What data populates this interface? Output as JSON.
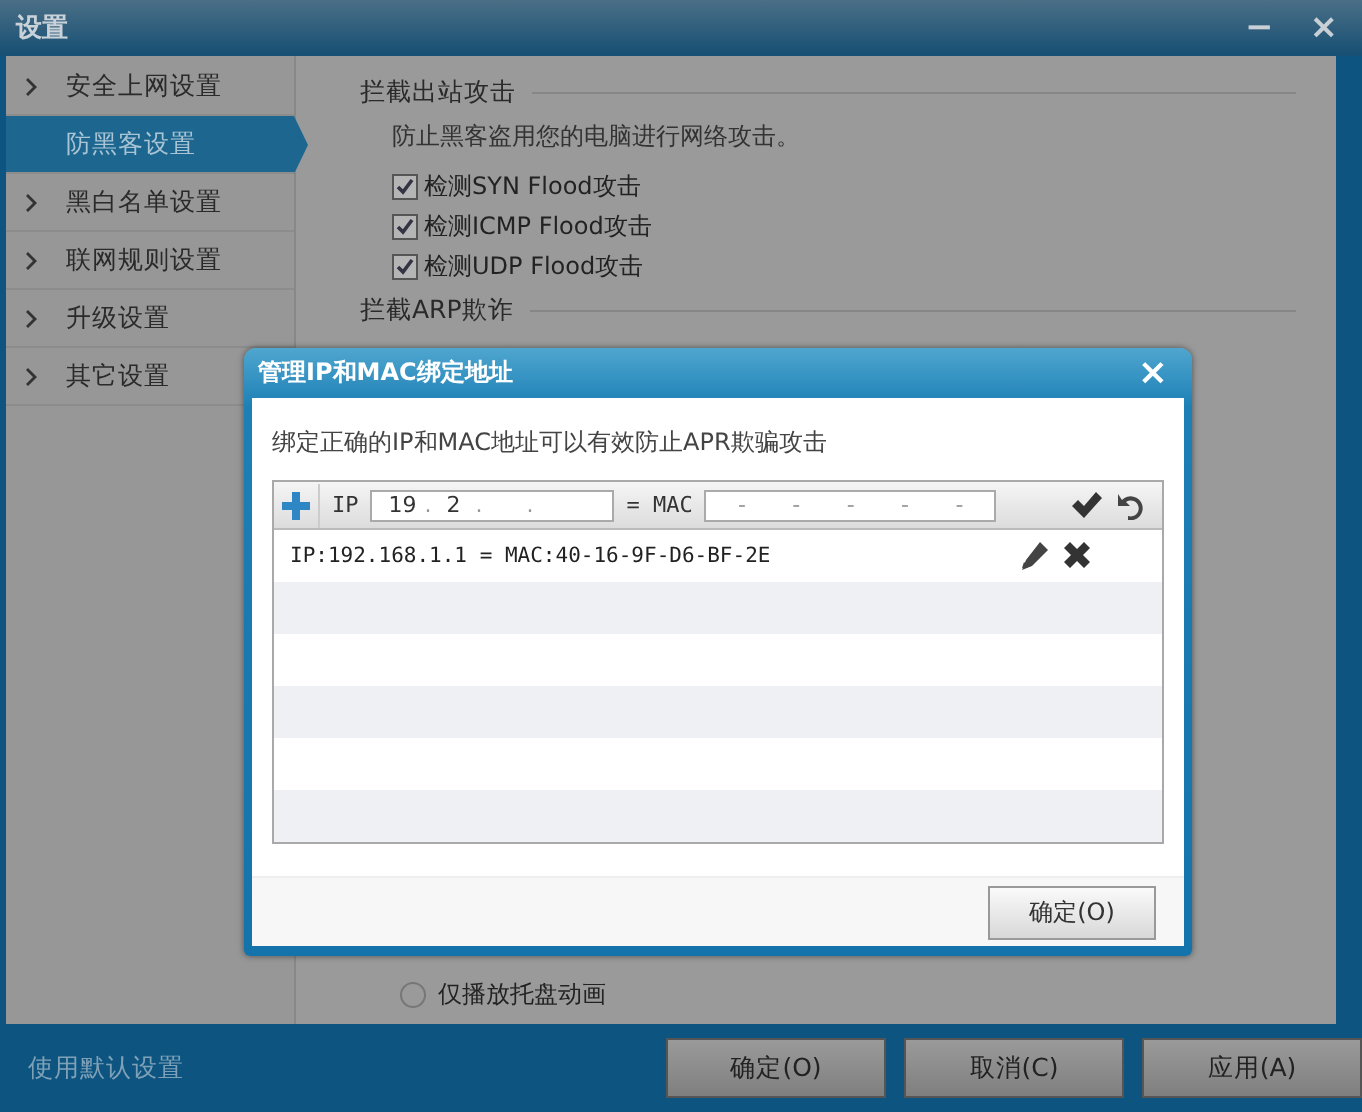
{
  "window": {
    "title": "设置",
    "controls": [
      "−",
      "×"
    ]
  },
  "sidebar": {
    "items": [
      {
        "label": "安全上网设置",
        "selected": false
      },
      {
        "label": "防黑客设置",
        "selected": true
      },
      {
        "label": "黑白名单设置",
        "selected": false
      },
      {
        "label": "联网规则设置",
        "selected": false
      },
      {
        "label": "升级设置",
        "selected": false
      },
      {
        "label": "其它设置",
        "selected": false
      }
    ]
  },
  "content": {
    "sections": [
      {
        "heading": "拦截出站攻击",
        "description": "防止黑客盗用您的电脑进行网络攻击。",
        "options": [
          {
            "label": "检测SYN Flood攻击",
            "checked": true
          },
          {
            "label": "检测ICMP Flood攻击",
            "checked": true
          },
          {
            "label": "检测UDP Flood攻击",
            "checked": true
          }
        ]
      },
      {
        "heading": "拦截ARP欺诈"
      }
    ],
    "radio": {
      "label": "仅播放托盘动画",
      "selected": false
    }
  },
  "dialog": {
    "title": "管理IP和MAC绑定地址",
    "close": "×",
    "description": "绑定正确的IP和MAC地址可以有效防止APR欺骗攻击",
    "ip_label": "IP",
    "ip_segments": [
      "19",
      "2"
    ],
    "ip_separator": ".",
    "equals": "= MAC",
    "mac_separator": "-",
    "entries": [
      {
        "text": "IP:192.168.1.1 = MAC:40-16-9F-D6-BF-2E"
      }
    ],
    "ok_button": "确定(O)"
  },
  "footer": {
    "link": "使用默认设置",
    "buttons": [
      "确定(O)",
      "取消(C)",
      "应用(A)"
    ]
  }
}
